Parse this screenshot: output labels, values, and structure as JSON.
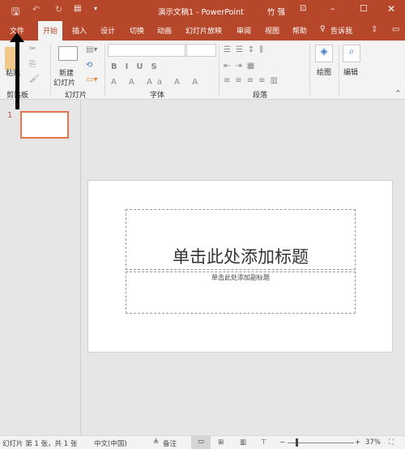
{
  "titlebar": {
    "title": "演示文稿1  -  PowerPoint",
    "user": "竹 强",
    "icons": [
      "save-icon",
      "undo-icon",
      "redo-icon",
      "slideshow-start-icon",
      "customize-icon",
      "ribbon-display-icon",
      "minimize-icon",
      "maximize-icon",
      "close-icon"
    ]
  },
  "tabs": [
    "文件",
    "开始",
    "插入",
    "设计",
    "切换",
    "动画",
    "幻灯片放映",
    "审阅",
    "视图",
    "帮助"
  ],
  "tell_me": "告诉我",
  "ribbon": {
    "paste": "粘贴",
    "new_slide_1": "新建",
    "new_slide_2": "幻灯片",
    "draw": "绘图",
    "edit": "编辑",
    "groups": [
      "剪贴板",
      "幻灯片",
      "字体",
      "段落"
    ],
    "font_name": "",
    "font_size": ""
  },
  "thumbnail": {
    "number": "1"
  },
  "slide": {
    "title_placeholder": "单击此处添加标题",
    "subtitle_placeholder": "单击此处添加副标题"
  },
  "status": {
    "slide_info": "幻灯片 第 1 张，共 1 张",
    "language": "中文(中国)",
    "notes": "备注",
    "zoom": "37%",
    "zoom_value": 37
  },
  "colors": {
    "accent": "#b7472a",
    "thumb_border": "#e8734f"
  }
}
